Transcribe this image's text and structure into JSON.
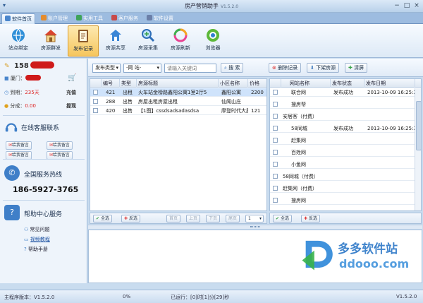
{
  "window": {
    "title": "房产营销助手",
    "version": "V1.5.2.0",
    "minimize": "−",
    "maximize": "□",
    "close": "×"
  },
  "tabs": [
    {
      "label": "软件首页",
      "active": true,
      "icon_color": "#4a86cc"
    },
    {
      "label": "账户管理",
      "active": false,
      "icon_color": "#e58c2d"
    },
    {
      "label": "实用工具",
      "active": false,
      "icon_color": "#3fa35a"
    },
    {
      "label": "客户服务",
      "active": false,
      "icon_color": "#c84a4a"
    },
    {
      "label": "软件设置",
      "active": false,
      "icon_color": "#6b7fa8"
    }
  ],
  "ribbon": [
    {
      "label": "站点绑定",
      "icon": "site-bind-icon",
      "selected": false
    },
    {
      "label": "房源群发",
      "icon": "house-broadcast-icon",
      "selected": false
    },
    {
      "label": "发布记录",
      "icon": "publish-record-icon",
      "selected": true
    },
    {
      "label": "房源共享",
      "icon": "house-share-icon",
      "selected": false
    },
    {
      "label": "房源采集",
      "icon": "house-collect-icon",
      "selected": false
    },
    {
      "label": "房源刷新",
      "icon": "house-refresh-icon",
      "selected": false
    },
    {
      "label": "浏览器",
      "icon": "browser-icon",
      "selected": false
    }
  ],
  "account": {
    "phone_prefix": "158",
    "store_label": "厦门：",
    "expire_label": "到期：",
    "expire_value": "235天",
    "expire_action": "充值",
    "points_label": "分成：",
    "points_value": "0.00",
    "points_action": "提现"
  },
  "service": {
    "title": "在线客服联系",
    "msg_btn_1": "给我留言",
    "msg_btn_2": "给我留言",
    "msg_btn_3": "给我留言",
    "msg_btn_4": "给我留言"
  },
  "hotline": {
    "title": "全国服务热线",
    "number": "186-5927-3765"
  },
  "help": {
    "title": "帮助中心服务",
    "links": [
      "常见问题",
      "视频教程",
      "帮助手册"
    ]
  },
  "toolbar": {
    "type_select": "发布类型",
    "site_select": "-网  站-",
    "keyword_placeholder": "请输入关键词",
    "search_btn": "搜 索",
    "delete_btn": "删除记录",
    "takedown_btn": "下架房源",
    "clear_btn": "清屏"
  },
  "left_table": {
    "headers": [
      "编号",
      "类型",
      "房源标题",
      "小区名称",
      "价格"
    ],
    "rows": [
      {
        "id": "421",
        "type": "出租",
        "title": "火车站金榜路鑫阳公寓1室2厅5",
        "community": "鑫阳公寓",
        "price": "2200",
        "selected": true
      },
      {
        "id": "288",
        "type": "出售",
        "title": "房屋出租房屋出租",
        "community": "仙阁山庄",
        "price": "",
        "selected": false
      },
      {
        "id": "420",
        "type": "出售",
        "title": "【1图】cssdsadsadasdsa",
        "community": "摩登时代大厦",
        "price": "121",
        "selected": false
      }
    ]
  },
  "right_table": {
    "headers": [
      "网站名称",
      "发布状态",
      "发布日期"
    ],
    "rows": [
      {
        "site": "联合网",
        "status": "发布成功",
        "date": "2013-10-09 16:25:3"
      },
      {
        "site": "搜房帮",
        "status": "",
        "date": ""
      },
      {
        "site": "安居客（付费）",
        "status": "",
        "date": ""
      },
      {
        "site": "58同城",
        "status": "发布成功",
        "date": "2013-10-09 16:25:3"
      },
      {
        "site": "赶集网",
        "status": "",
        "date": ""
      },
      {
        "site": "百姓网",
        "status": "",
        "date": ""
      },
      {
        "site": "小鱼网",
        "status": "",
        "date": ""
      },
      {
        "site": "58同城（付费）",
        "status": "",
        "date": ""
      },
      {
        "site": "赶集网（付费）",
        "status": "",
        "date": ""
      },
      {
        "site": "搜房网",
        "status": "",
        "date": ""
      }
    ]
  },
  "left_bar": {
    "select_all": "全选",
    "invert": "反选",
    "first": "首页",
    "prev": "上页",
    "next": "下页",
    "last": "尾页",
    "page": "1"
  },
  "right_bar": {
    "select_all": "全选",
    "invert": "反选"
  },
  "status": {
    "version_label": "主程序版本：V1.5.2.0",
    "progress": "0%",
    "elapsed": "已运行：[0]时[1]分[29]秒",
    "version_right": "V1.5.2.0"
  },
  "watermark": {
    "cn": "多多软件站",
    "en": "ddooo.com"
  }
}
